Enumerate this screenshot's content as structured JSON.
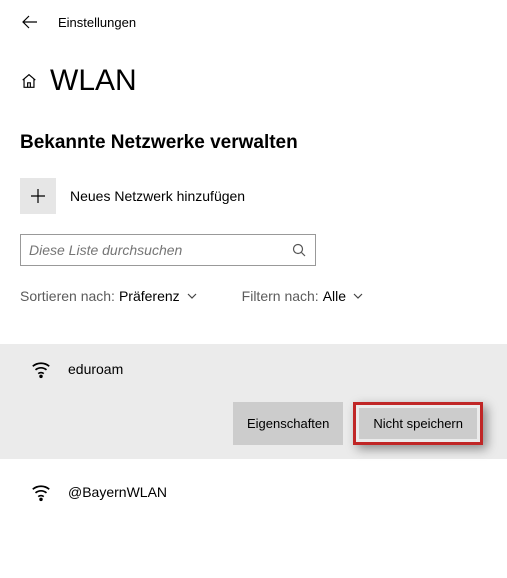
{
  "header": {
    "back": "Zurück",
    "settings": "Einstellungen"
  },
  "page": {
    "home": "Start",
    "title": "WLAN"
  },
  "section": {
    "title": "Bekannte Netzwerke verwalten"
  },
  "add": {
    "label": "Neues Netzwerk hinzufügen"
  },
  "search": {
    "placeholder": "Diese Liste durchsuchen"
  },
  "sort": {
    "label": "Sortieren nach:",
    "value": "Präferenz"
  },
  "filter": {
    "label": "Filtern nach:",
    "value": "Alle"
  },
  "networks": [
    {
      "name": "eduroam",
      "selected": true
    },
    {
      "name": "@BayernWLAN",
      "selected": false
    }
  ],
  "buttons": {
    "properties": "Eigenschaften",
    "forget": "Nicht speichern"
  }
}
